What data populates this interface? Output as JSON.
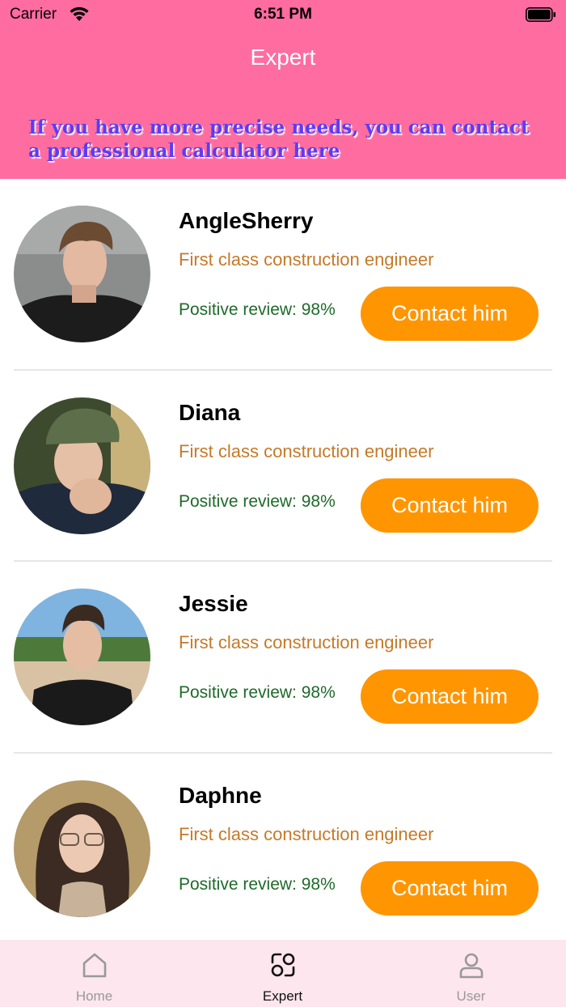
{
  "status_bar": {
    "carrier": "Carrier",
    "time": "6:51 PM"
  },
  "header": {
    "title": "Expert",
    "banner": "If you have more precise needs, you can contact a professional calculator here",
    "background_color": "#ff6ca0",
    "banner_color": "#5b3cf5"
  },
  "experts": [
    {
      "name": "AngleSherry",
      "title": "First class construction engineer",
      "review": "Positive review: 98%",
      "contact_label": "Contact him"
    },
    {
      "name": "Diana",
      "title": "First class construction engineer",
      "review": "Positive review: 98%",
      "contact_label": "Contact him"
    },
    {
      "name": "Jessie",
      "title": "First class construction engineer",
      "review": "Positive review: 98%",
      "contact_label": "Contact him"
    },
    {
      "name": "Daphne",
      "title": "First class construction engineer",
      "review": "Positive review: 98%",
      "contact_label": "Contact him"
    }
  ],
  "colors": {
    "accent": "#ff9500",
    "title_text": "#c47a2a",
    "review_text": "#1e6a2a",
    "tabbar_bg": "#fde6ee"
  },
  "tabbar": {
    "tabs": [
      {
        "label": "Home",
        "icon": "home-icon",
        "active": false
      },
      {
        "label": "Expert",
        "icon": "expert-icon",
        "active": true
      },
      {
        "label": "User",
        "icon": "user-icon",
        "active": false
      }
    ]
  }
}
